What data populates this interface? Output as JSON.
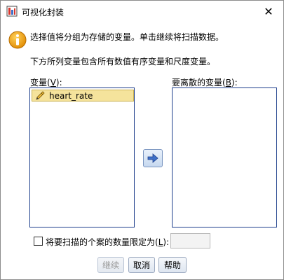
{
  "window": {
    "title": "可视化封装",
    "close_glyph": "✕"
  },
  "messages": {
    "line1": "选择值将分组为存储的变量。单击继续将扫描数据。",
    "line2": "下方所列变量包含所有数值有序变量和尺度变量。"
  },
  "variables_list": {
    "label": "变量(",
    "label_key": "V",
    "label_end": "):",
    "items": [
      "heart_rate"
    ]
  },
  "binned_list": {
    "label": "要离散的变量(",
    "label_key": "B",
    "label_end": "):",
    "items": []
  },
  "limit": {
    "label": "将要扫描的个案的数量限定为(",
    "label_key": "L",
    "label_end": "):",
    "value": "",
    "checked": false
  },
  "buttons": {
    "continue": "继续",
    "cancel": "取消",
    "help": "帮助"
  },
  "colors": {
    "selected_item": "#f5e39c",
    "list_border": "#1e3f8c",
    "arrow": "#3d6fc7"
  },
  "icons": {
    "app": "app-icon",
    "info": "info-icon",
    "item": "pencil-icon",
    "move": "arrow-right-icon"
  }
}
